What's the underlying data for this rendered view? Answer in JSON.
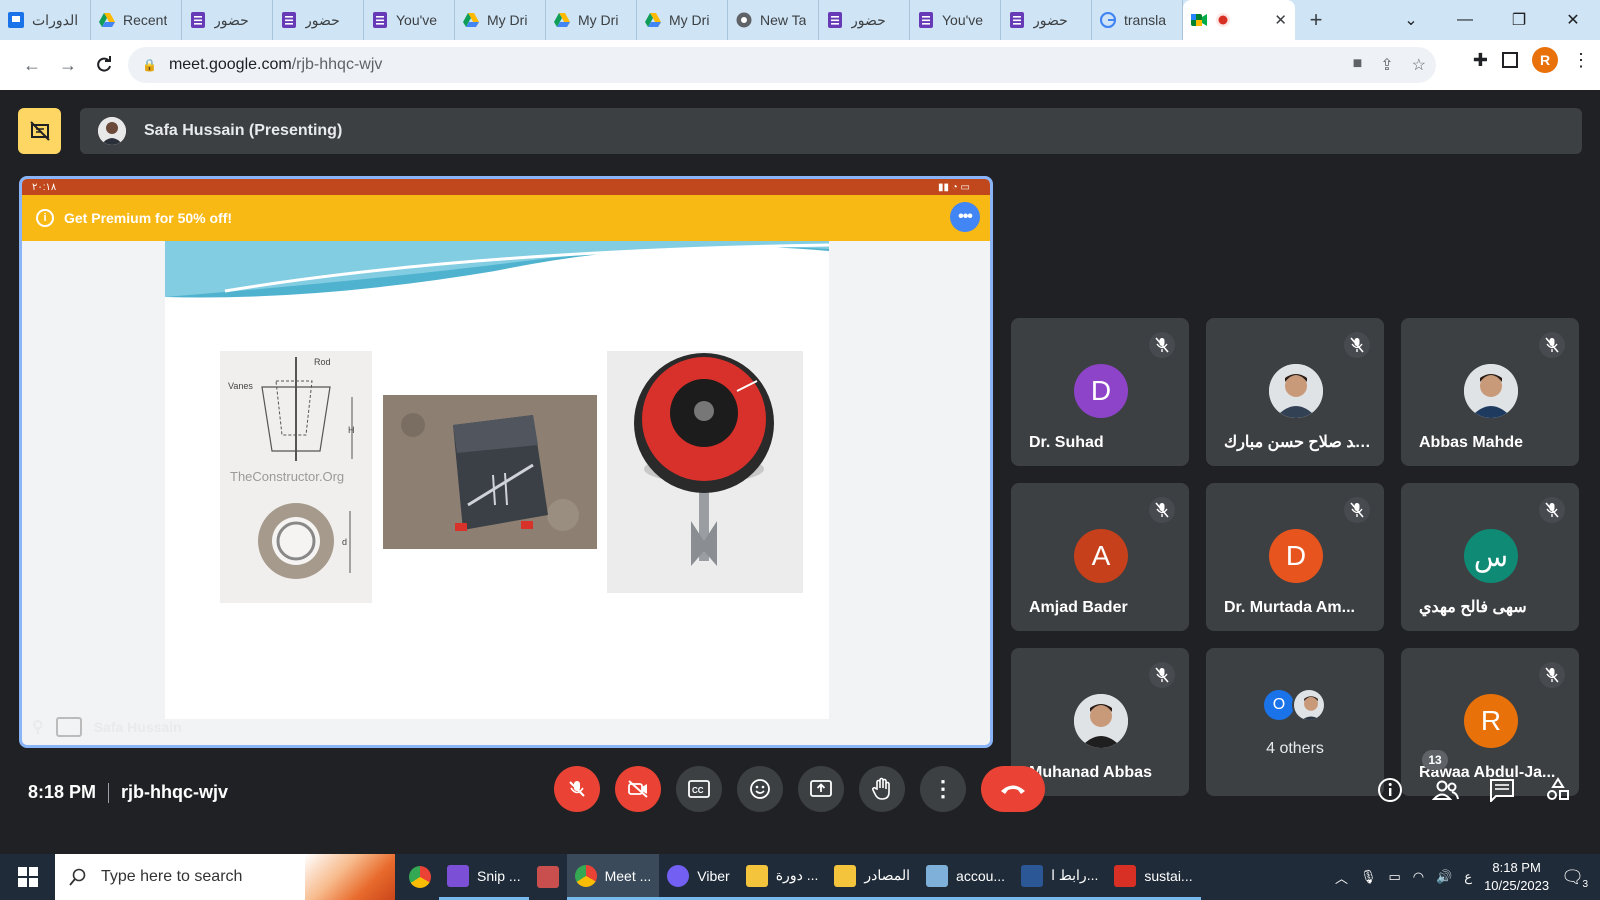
{
  "browser": {
    "tabs": [
      {
        "title": "الدورات",
        "icon": "classroom-icon"
      },
      {
        "title": "Recent",
        "icon": "drive-icon"
      },
      {
        "title": "حضور",
        "icon": "forms-icon"
      },
      {
        "title": "حضور",
        "icon": "forms-icon"
      },
      {
        "title": "You've",
        "icon": "forms-icon"
      },
      {
        "title": "My Dri",
        "icon": "drive-icon"
      },
      {
        "title": "My Dri",
        "icon": "drive-icon"
      },
      {
        "title": "My Dri",
        "icon": "drive-icon"
      },
      {
        "title": "New Ta",
        "icon": "chrome-icon"
      },
      {
        "title": "حضور",
        "icon": "forms-icon"
      },
      {
        "title": "You've",
        "icon": "forms-icon"
      },
      {
        "title": "حضور",
        "icon": "forms-icon"
      },
      {
        "title": "transla",
        "icon": "google-icon"
      }
    ],
    "active_tab": {
      "title": "",
      "icon": "meet-icon"
    },
    "url_host": "meet.google.com",
    "url_path": "/rjb-hhqc-wjv",
    "profile_initial": "R"
  },
  "meet": {
    "presenter_label": "Safa Hussain (Presenting)",
    "presentation": {
      "promo_text": "Get Premium for 50% off!",
      "status_time": "٢٠:١٨",
      "watermark": "TheConstructor.Org",
      "diagram_labels": {
        "rod": "Rod",
        "vanes": "Vanes",
        "h": "H",
        "d": "d"
      },
      "presenter_name": "Safa Hussain"
    },
    "participants": [
      {
        "name": "Dr. Suhad",
        "initial": "D",
        "color": "#8e44c9",
        "photo": false,
        "muted": true
      },
      {
        "name": "مهند صلاح حسن مبارك",
        "initial": "",
        "color": "#e0e0e0",
        "photo": true,
        "muted": true
      },
      {
        "name": "Abbas Mahde",
        "initial": "",
        "color": "#cfd8dc",
        "photo": true,
        "muted": true
      },
      {
        "name": "Amjad Bader",
        "initial": "A",
        "color": "#c5401b",
        "photo": false,
        "muted": true
      },
      {
        "name": "Dr. Murtada Am...",
        "initial": "D",
        "color": "#e8541e",
        "photo": false,
        "muted": true
      },
      {
        "name": "سهى فالح مهدي",
        "initial": "س",
        "color": "#0f8a75",
        "photo": false,
        "muted": true
      },
      {
        "name": "Muhanad Abbas",
        "initial": "",
        "color": "#e0e0e0",
        "photo": true,
        "muted": true
      },
      {
        "name": "4 others",
        "initial": "O",
        "color": "#1a73e8",
        "photo": false,
        "muted": false,
        "group": true
      },
      {
        "name": "Rawaa Abdul-Ja...",
        "initial": "R",
        "color": "#e8710a",
        "photo": false,
        "muted": true
      }
    ],
    "time": "8:18 PM",
    "meeting_code": "rjb-hhqc-wjv",
    "people_count": "13"
  },
  "taskbar": {
    "search_placeholder": "Type here to search",
    "items": [
      {
        "label": "",
        "icon": "chrome-icon",
        "color": "#4285f4",
        "state": "none"
      },
      {
        "label": "Snip ...",
        "icon": "snip-icon",
        "color": "#7b4fd6",
        "state": "open"
      },
      {
        "label": "",
        "icon": "app-icon",
        "color": "#c94f4f",
        "state": "none"
      },
      {
        "label": "Meet ...",
        "icon": "chrome-icon",
        "color": "#4285f4",
        "state": "active"
      },
      {
        "label": "Viber",
        "icon": "viber-icon",
        "color": "#7360f2",
        "state": "open"
      },
      {
        "label": "دورة ...",
        "icon": "folder-icon",
        "color": "#f3c43c",
        "state": "open"
      },
      {
        "label": "المصادر",
        "icon": "folder-icon",
        "color": "#f3c43c",
        "state": "open"
      },
      {
        "label": "accou...",
        "icon": "app-icon",
        "color": "#7fb0d9",
        "state": "open"
      },
      {
        "label": "رابط ا...",
        "icon": "word-icon",
        "color": "#2b5797",
        "state": "open"
      },
      {
        "label": "sustai...",
        "icon": "pdf-icon",
        "color": "#d93025",
        "state": "open"
      }
    ],
    "lang": "ع",
    "time": "8:18 PM",
    "date": "10/25/2023",
    "notifications": "3"
  }
}
